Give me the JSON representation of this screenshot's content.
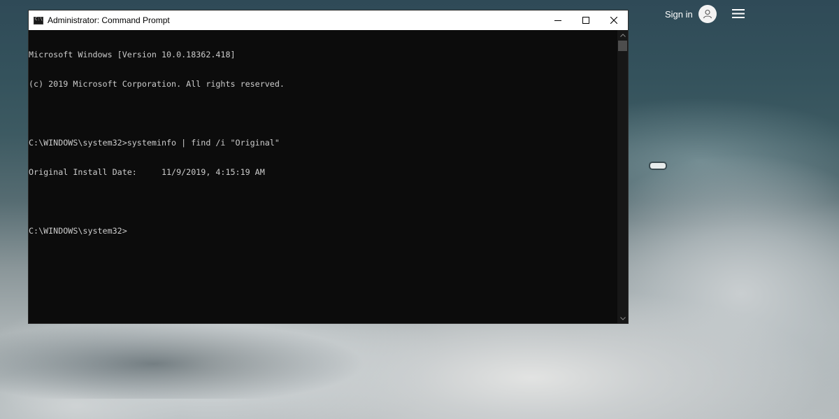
{
  "browser": {
    "signin_label": "Sign in",
    "avatar_icon": "user-icon",
    "menu_icon": "hamburger-menu-icon"
  },
  "window": {
    "title": "Administrator: Command Prompt",
    "icon": "cmd-icon",
    "controls": {
      "minimize_icon": "minimize-icon",
      "maximize_icon": "maximize-icon",
      "close_icon": "close-icon"
    }
  },
  "console": {
    "lines": [
      "Microsoft Windows [Version 10.0.18362.418]",
      "(c) 2019 Microsoft Corporation. All rights reserved.",
      "",
      "C:\\WINDOWS\\system32>systeminfo | find /i \"Original\"",
      "Original Install Date:     11/9/2019, 4:15:19 AM",
      "",
      "C:\\WINDOWS\\system32>"
    ]
  },
  "colors": {
    "console_bg": "#0c0c0c",
    "console_text": "#cccccc",
    "titlebar_bg": "#ffffff"
  }
}
